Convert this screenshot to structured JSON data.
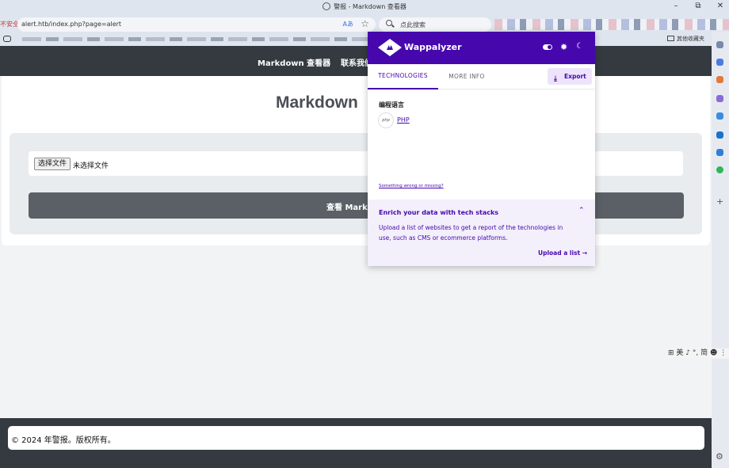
{
  "window": {
    "title": "警报 - Markdown 查看器",
    "controls": {
      "minimize": "–",
      "restore": "⧉",
      "close": "✕"
    }
  },
  "addressbar": {
    "security_label": "不安全",
    "url": "alert.htb/index.php?page=alert",
    "read_mode": "Aあ",
    "star": "☆"
  },
  "search": {
    "placeholder": "点此搜索"
  },
  "bookmarks": {
    "other_label": "其他收藏夹"
  },
  "site": {
    "nav": {
      "brand": "Markdown 查看器",
      "contact": "联系我们"
    },
    "heading": "Markdown",
    "file_button": "选择文件",
    "file_status": "未选择文件",
    "view_button": "查看 Markdown",
    "footer": "© 2024 年警报。版权所有。"
  },
  "ime": {
    "text": "⊞ 美 ♪ °, 简 ☻ ⋮⋮"
  },
  "sidebar": {
    "plus": "+",
    "settings": "⚙"
  },
  "wappalyzer": {
    "title": "Wappalyzer",
    "settings_icon": "✹",
    "theme_icon": "☾",
    "tabs": [
      "TECHNOLOGIES",
      "MORE INFO"
    ],
    "export_label": "Export",
    "export_icon": "⤓",
    "category": "编程语言",
    "tech_icon_text": "php",
    "tech_name": "PHP",
    "missing_link": "Something wrong or missing?",
    "enrich_title": "Enrich your data with tech stacks",
    "enrich_chevron": "⌃",
    "enrich_desc": "Upload a list of websites to get a report of the technologies in use, such as CMS or ecommerce platforms.",
    "upload_label": "Upload a list →",
    "colors": {
      "brand": "#4608ad",
      "enrich_bg": "#f3effb"
    }
  },
  "colors": {
    "navbar": "#343a40",
    "view_button": "#5a6066"
  }
}
